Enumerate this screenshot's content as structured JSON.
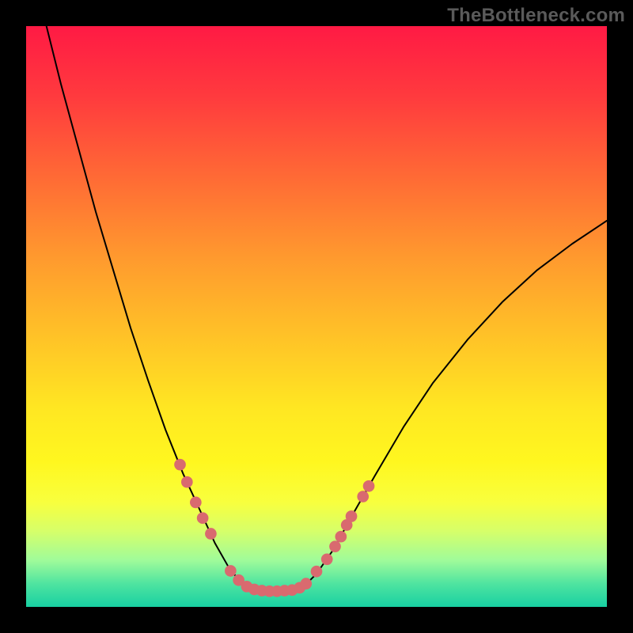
{
  "watermark": {
    "text": "TheBottleneck.com"
  },
  "chart_data": {
    "type": "line",
    "title": "",
    "xlabel": "",
    "ylabel": "",
    "xlim": [
      0,
      100
    ],
    "ylim": [
      0,
      100
    ],
    "grid": false,
    "legend": false,
    "series": [
      {
        "name": "curve-left",
        "stroke": "#000000",
        "values": [
          [
            3.5,
            100
          ],
          [
            6,
            90
          ],
          [
            9,
            79
          ],
          [
            12,
            68
          ],
          [
            15,
            58
          ],
          [
            18,
            48
          ],
          [
            21,
            39
          ],
          [
            24,
            30.5
          ],
          [
            27,
            23
          ],
          [
            30,
            16.5
          ],
          [
            32.5,
            11
          ],
          [
            35,
            6.6
          ],
          [
            37,
            4.2
          ],
          [
            38.5,
            3.2
          ],
          [
            40,
            2.8
          ]
        ]
      },
      {
        "name": "flat-center",
        "stroke": "#000000",
        "values": [
          [
            40,
            2.8
          ],
          [
            42,
            2.7
          ],
          [
            44,
            2.7
          ],
          [
            46,
            2.8
          ]
        ]
      },
      {
        "name": "curve-right",
        "stroke": "#000000",
        "values": [
          [
            46,
            2.9
          ],
          [
            48,
            3.7
          ],
          [
            50,
            5.7
          ],
          [
            53,
            10
          ],
          [
            56,
            15.5
          ],
          [
            60,
            22.5
          ],
          [
            65,
            31
          ],
          [
            70,
            38.5
          ],
          [
            76,
            46
          ],
          [
            82,
            52.5
          ],
          [
            88,
            58
          ],
          [
            94,
            62.5
          ],
          [
            100,
            66.5
          ]
        ]
      }
    ],
    "scatter": {
      "name": "dots",
      "color": "#d96a6f",
      "radius_pct": 1.0,
      "points": [
        [
          26.5,
          24.5
        ],
        [
          27.7,
          21.5
        ],
        [
          29.2,
          18.0
        ],
        [
          30.4,
          15.3
        ],
        [
          31.8,
          12.6
        ],
        [
          50.0,
          6.1
        ],
        [
          51.8,
          8.2
        ],
        [
          53.2,
          10.4
        ],
        [
          54.2,
          12.1
        ],
        [
          55.2,
          14.1
        ],
        [
          56.0,
          15.6
        ],
        [
          58.0,
          19.0
        ],
        [
          59.0,
          20.8
        ]
      ]
    },
    "beaded_band": {
      "name": "base-band",
      "color": "#d96a6f",
      "radius_pct": 1.0,
      "points": [
        [
          35.2,
          6.2
        ],
        [
          36.6,
          4.6
        ],
        [
          38.0,
          3.5
        ],
        [
          39.3,
          3.0
        ],
        [
          40.6,
          2.8
        ],
        [
          41.9,
          2.7
        ],
        [
          43.2,
          2.7
        ],
        [
          44.5,
          2.8
        ],
        [
          45.8,
          2.9
        ],
        [
          47.1,
          3.3
        ],
        [
          48.2,
          4.0
        ]
      ]
    }
  }
}
